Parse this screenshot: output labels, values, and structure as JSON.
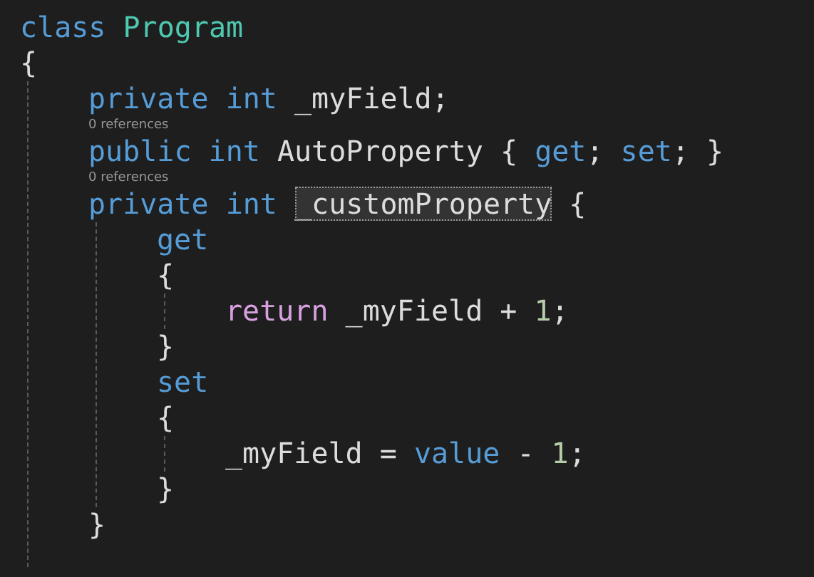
{
  "editor": {
    "lines": [
      {
        "tokens": [
          {
            "kind": "keyword",
            "text": "class "
          },
          {
            "kind": "type",
            "text": "Program"
          }
        ]
      },
      {
        "tokens": [
          {
            "kind": "plain",
            "text": "{"
          }
        ],
        "children": [
          {
            "tokens": [
              {
                "kind": "keyword",
                "text": "private int "
              },
              {
                "kind": "plain",
                "text": "_myField;"
              }
            ]
          },
          {
            "references": "0 references",
            "tokens": [
              {
                "kind": "keyword",
                "text": "public int "
              },
              {
                "kind": "plain",
                "text": "AutoProperty { "
              },
              {
                "kind": "keyword",
                "text": "get"
              },
              {
                "kind": "plain",
                "text": "; "
              },
              {
                "kind": "keyword",
                "text": "set"
              },
              {
                "kind": "plain",
                "text": "; }"
              }
            ]
          },
          {
            "references": "0 references",
            "tokens": [
              {
                "kind": "keyword",
                "text": "private int "
              },
              {
                "kind": "plain",
                "text": "_customProperty",
                "highlighted": true
              },
              {
                "kind": "plain",
                "text": " {"
              }
            ],
            "children": [
              {
                "tokens": [
                  {
                    "kind": "keyword",
                    "text": "get"
                  }
                ]
              },
              {
                "tokens": [
                  {
                    "kind": "plain",
                    "text": "{"
                  }
                ],
                "children": [
                  {
                    "tokens": [
                      {
                        "kind": "control",
                        "text": "return "
                      },
                      {
                        "kind": "plain",
                        "text": "_myField + "
                      },
                      {
                        "kind": "number",
                        "text": "1"
                      },
                      {
                        "kind": "plain",
                        "text": ";"
                      }
                    ]
                  }
                ]
              },
              {
                "tokens": [
                  {
                    "kind": "plain",
                    "text": "}"
                  }
                ]
              },
              {
                "tokens": [
                  {
                    "kind": "keyword",
                    "text": "set"
                  }
                ]
              },
              {
                "tokens": [
                  {
                    "kind": "plain",
                    "text": "{"
                  }
                ],
                "children": [
                  {
                    "tokens": [
                      {
                        "kind": "plain",
                        "text": "_myField = "
                      },
                      {
                        "kind": "keyword",
                        "text": "value "
                      },
                      {
                        "kind": "plain",
                        "text": "- "
                      },
                      {
                        "kind": "number",
                        "text": "1"
                      },
                      {
                        "kind": "plain",
                        "text": ";"
                      }
                    ]
                  }
                ]
              },
              {
                "tokens": [
                  {
                    "kind": "plain",
                    "text": "}"
                  }
                ]
              }
            ]
          },
          {
            "tokens": [
              {
                "kind": "plain",
                "text": "}"
              }
            ]
          }
        ]
      }
    ]
  }
}
